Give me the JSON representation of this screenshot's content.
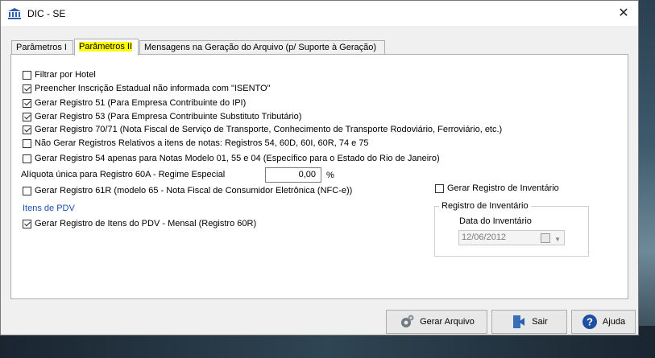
{
  "window": {
    "title": "DIC - SE",
    "close_label": "✕"
  },
  "tabs": [
    {
      "label": "Parâmetros I"
    },
    {
      "label": "Parâmetros II"
    },
    {
      "label": "Mensagens na Geração do Arquivo (p/ Suporte à Geração)"
    }
  ],
  "options": {
    "filtrar_hotel": {
      "label": "Filtrar por Hotel",
      "checked": false
    },
    "preencher_ie": {
      "label": "Preencher Inscrição Estadual não informada com \"ISENTO\"",
      "checked": true
    },
    "registro_51": {
      "label": "Gerar Registro 51 (Para Empresa Contribuinte do IPI)",
      "checked": true
    },
    "registro_53": {
      "label": "Gerar Registro 53 (Para Empresa Contribuinte Substituto Tributário)",
      "checked": true
    },
    "registro_7071": {
      "label": "Gerar Registro 70/71 (Nota Fiscal de Serviço de Transporte, Conhecimento de Transporte Rodoviário, Ferroviário, etc.)",
      "checked": true
    },
    "nao_gerar": {
      "label": "Não Gerar Registros Relativos a itens de notas: Registros 54, 60D, 60I, 60R, 74 e 75",
      "checked": false
    },
    "registro_54": {
      "label": "Gerar Registro 54 apenas para Notas Modelo 01, 55 e 04 (Específico para o Estado do Rio de Janeiro)",
      "checked": false
    },
    "registro_61r": {
      "label": "Gerar Registro 61R (modelo 65 - Nota Fiscal de Consumidor Eletrônica (NFC-e))",
      "checked": false
    },
    "inventario": {
      "label": "Gerar Registro de Inventário",
      "checked": false
    },
    "itens_pdv": {
      "label": "Gerar Registro de Itens do PDV - Mensal (Registro 60R)",
      "checked": true
    }
  },
  "aliquota": {
    "label": "Alíquota única para Registro 60A - Regime Especial",
    "value": "0,00",
    "unit": "%"
  },
  "itens_pdv_section": "Itens de PDV",
  "inventario_group": {
    "title": "Registro de Inventário",
    "date_label": "Data do Inventário",
    "date_value": "12/06/2012"
  },
  "buttons": {
    "gerar": "Gerar Arquivo",
    "sair": "Sair",
    "ajuda": "Ajuda"
  }
}
